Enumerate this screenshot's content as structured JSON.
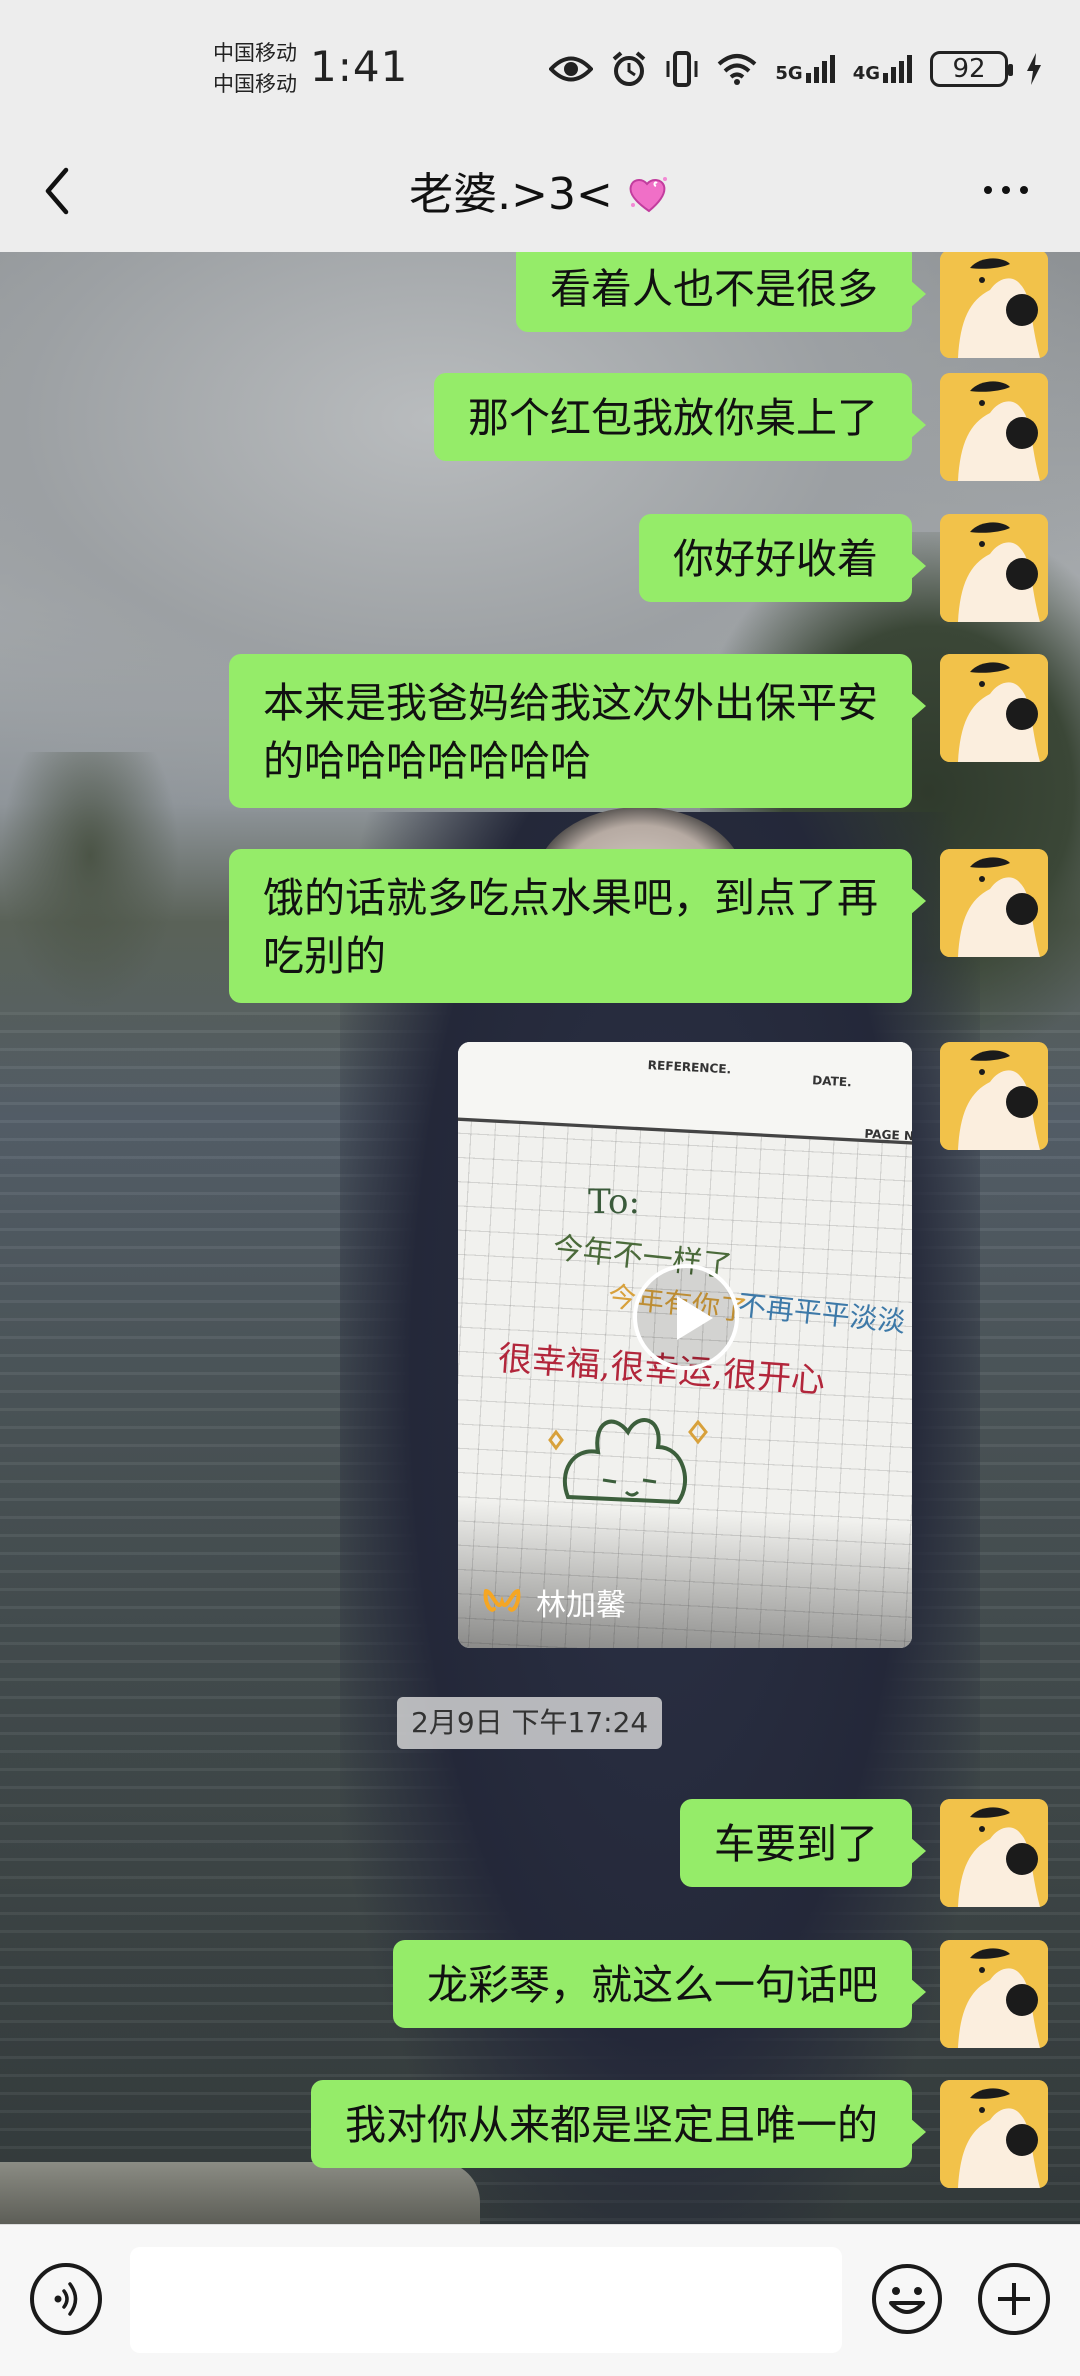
{
  "status_bar": {
    "carrier_1": "中国移动",
    "carrier_2": "中国移动",
    "time": "1:41",
    "network_1": "5G",
    "network_2": "4G",
    "battery": "92",
    "icons": [
      "eye-icon",
      "alarm-icon",
      "vibrate-icon",
      "wifi-icon",
      "signal-icon",
      "battery-icon",
      "charging-icon"
    ]
  },
  "header": {
    "title": "老婆.>3<",
    "title_emoji": "sparkling-heart-icon",
    "back": "back-icon",
    "more": "more-icon"
  },
  "messages": [
    {
      "text": "看着人也不是很多"
    },
    {
      "text": "那个红包我放你桌上了"
    },
    {
      "text": "你好好收着"
    },
    {
      "text": "本来是我爸妈给我这次外出保平安\n的哈哈哈哈哈哈哈"
    },
    {
      "text": "饿的话就多吃点水果吧，到点了再\n吃别的"
    }
  ],
  "video_card": {
    "header_labels": [
      "REFERENCE.",
      "DATE.",
      "PAGE NO."
    ],
    "handwriting": [
      "To:",
      "今年不一样了",
      "不再平平淡淡",
      "今年有你了",
      "很幸福,很幸运,很开心"
    ],
    "channel_name": "林加馨"
  },
  "timestamp": "2月9日 下午17:24",
  "messages_after": [
    {
      "text": "车要到了"
    },
    {
      "text": "龙彩琴，就这么一句话吧"
    },
    {
      "text": "我对你从来都是坚定且唯一的"
    }
  ],
  "colors": {
    "bubble": "#95ec69",
    "bar_background": "#ededed",
    "avatar_background": "#f2c24a"
  }
}
